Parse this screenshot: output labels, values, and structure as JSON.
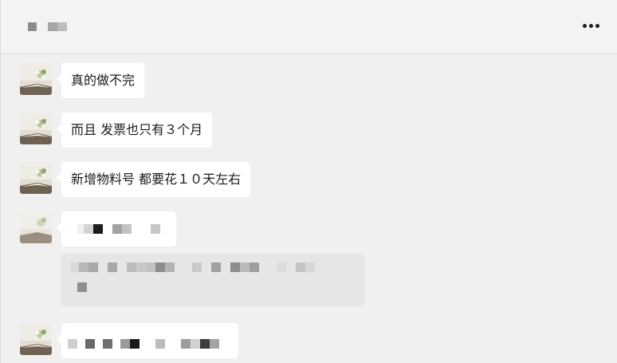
{
  "header": {
    "title_redacted": true,
    "more_icon": "more-horizontal-icon"
  },
  "messages": [
    {
      "text": "真的做不完"
    },
    {
      "text": "而且  发票也只有３个月"
    },
    {
      "text": "新增物料号  都要花１０天左右"
    },
    {
      "text": "",
      "redacted": true
    },
    {
      "text": "",
      "redacted": true
    }
  ],
  "quote": {
    "redacted": true
  },
  "colors": {
    "background": "#f0f0f0",
    "bubble": "#ffffff",
    "quote": "#e6e6e6"
  }
}
